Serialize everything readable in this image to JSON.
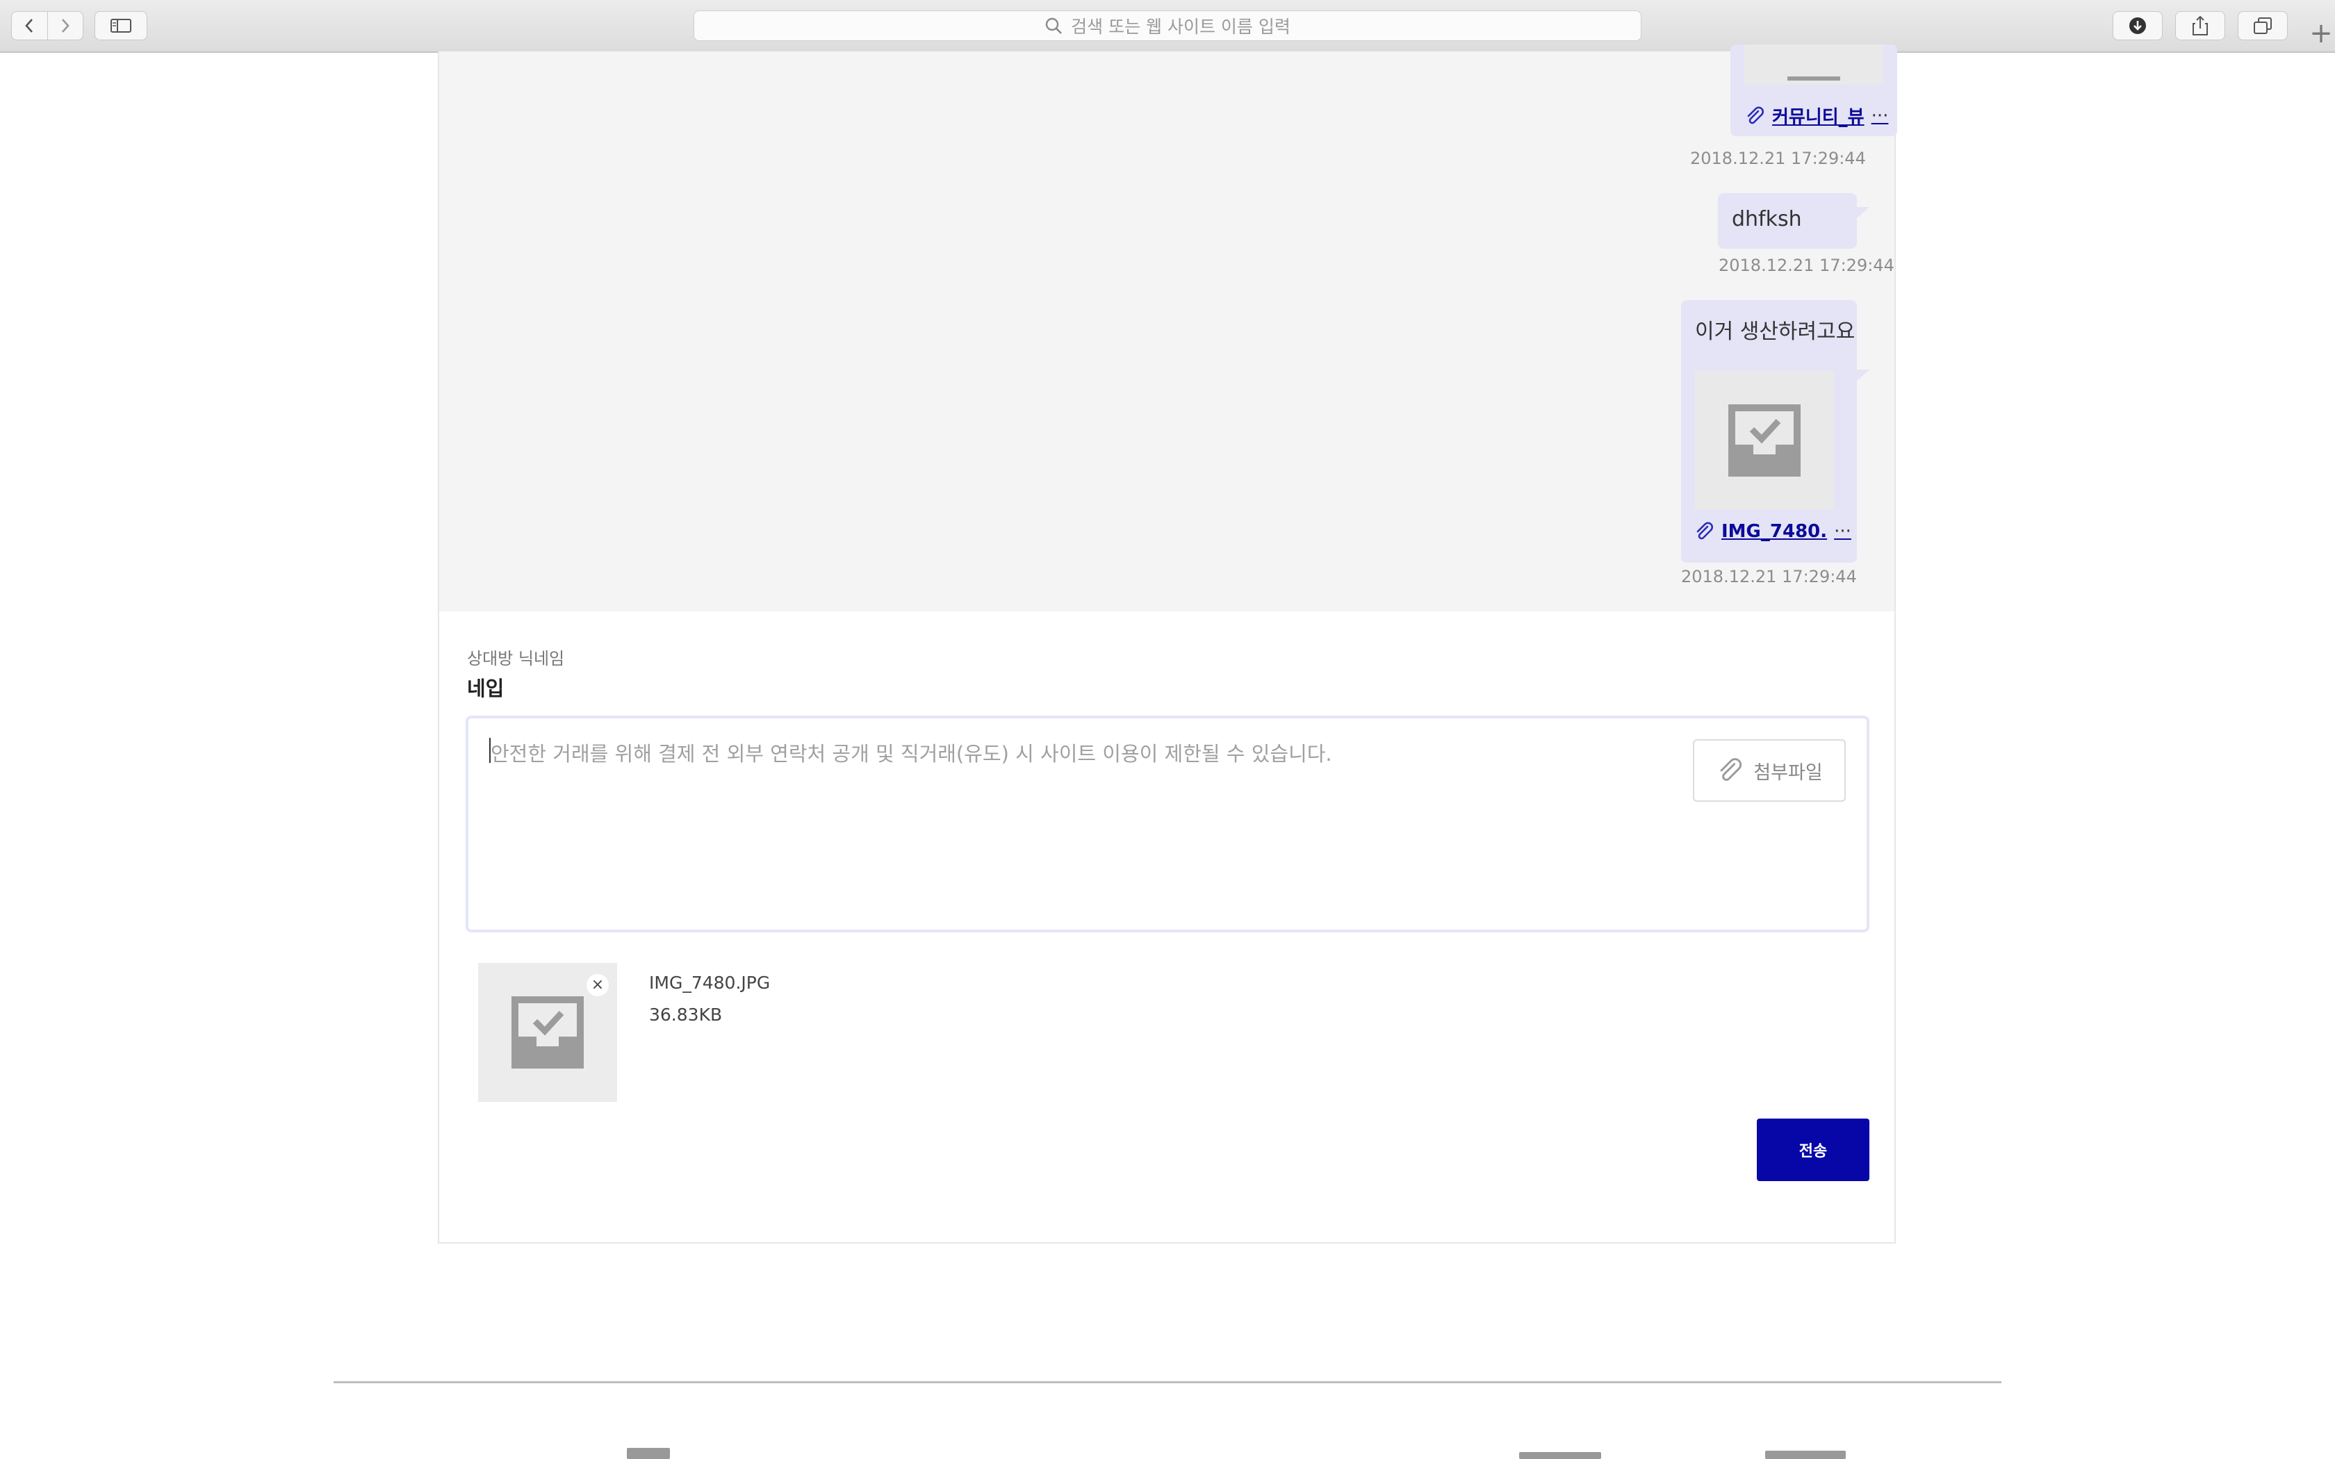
{
  "browser": {
    "address_placeholder": "검색 또는 웹 사이트 이름 입력",
    "new_tab": "+"
  },
  "messages": [
    {
      "attachment_label": "커뮤니티_뷰",
      "ellipsis": "···",
      "timestamp": "2018.12.21 17:29:44"
    },
    {
      "text": "dhfksh",
      "timestamp": "2018.12.21 17:29:44"
    },
    {
      "text": "이거 생산하려고요",
      "attachment_label": "IMG_7480.",
      "ellipsis": "···",
      "timestamp": "2018.12.21 17:29:44"
    }
  ],
  "compose": {
    "partner_label": "상대방 닉네임",
    "partner_name": "네입",
    "message_placeholder": "안전한 거래를 위해 결제 전 외부 연락처 공개 및 직거래(유도) 시 사이트 이용이 제한될 수 있습니다.",
    "attach_label": "첨부파일",
    "attachment": {
      "file_name": "IMG_7480.JPG",
      "file_size": "36.83KB",
      "remove": "×"
    },
    "send_label": "전송"
  },
  "colors": {
    "bubble": "#e5e4f6",
    "send_button": "#0707a8",
    "link": "#0b0b9a"
  }
}
